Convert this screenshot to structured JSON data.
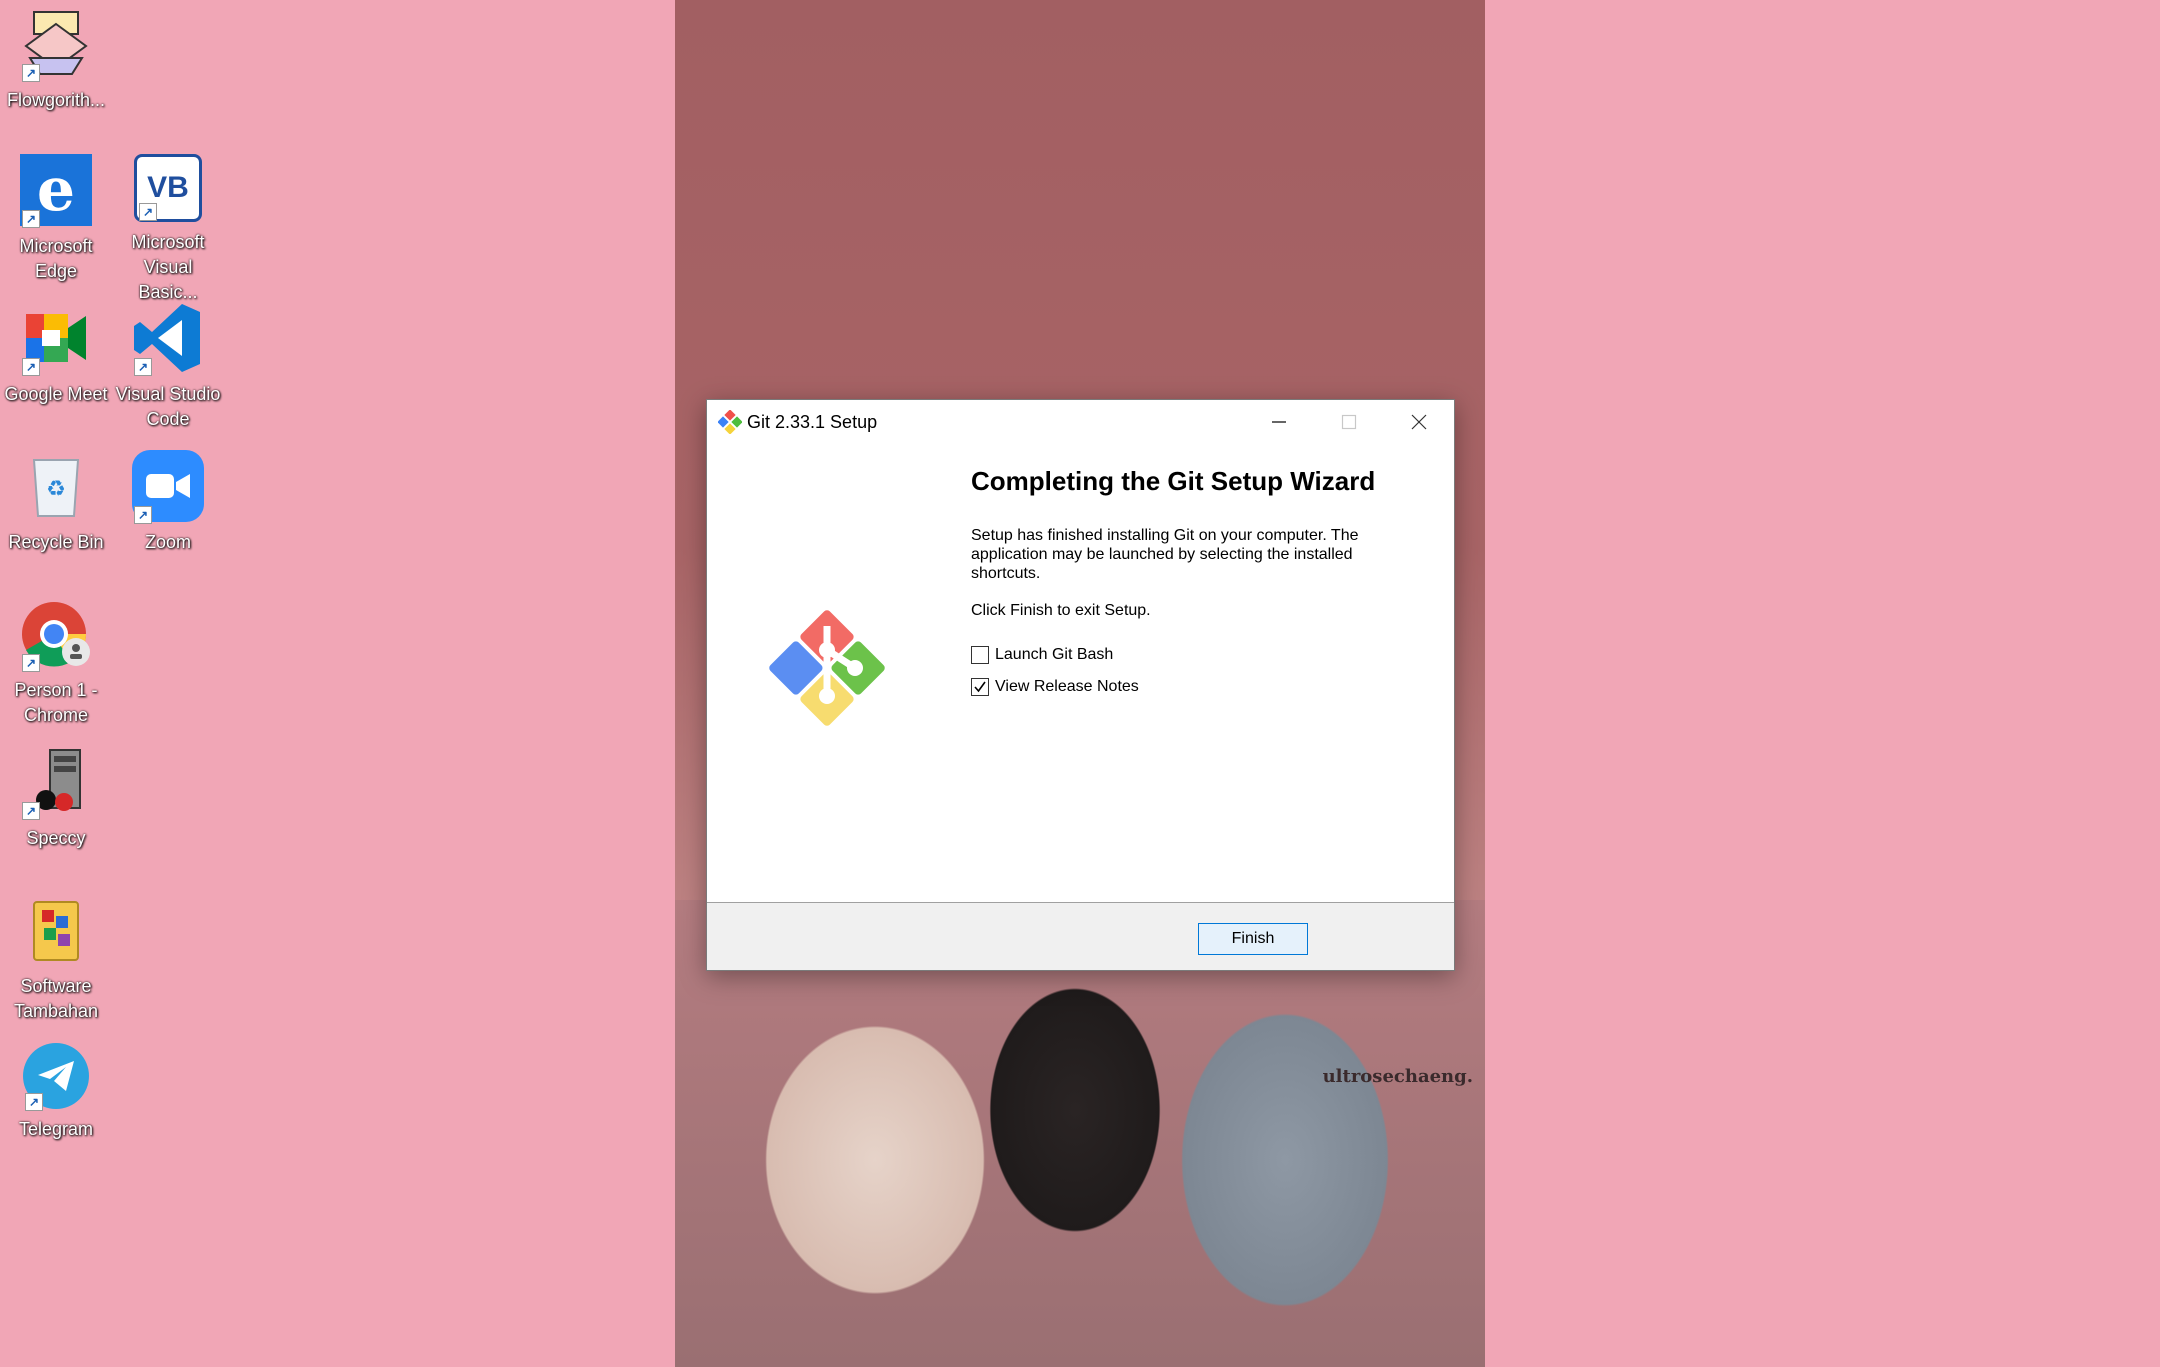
{
  "desktop": {
    "icons": [
      {
        "label": "Flowgorith...",
        "icon": "flowgorithm-icon"
      },
      {
        "label": "Microsoft Edge",
        "icon": "edge-icon"
      },
      {
        "label": "Microsoft Visual Basic...",
        "icon": "visual-basic-icon"
      },
      {
        "label": "Google Meet",
        "icon": "google-meet-icon"
      },
      {
        "label": "Visual Studio Code",
        "icon": "vscode-icon"
      },
      {
        "label": "Recycle Bin",
        "icon": "recycle-bin-icon"
      },
      {
        "label": "Zoom",
        "icon": "zoom-icon"
      },
      {
        "label": "Person 1 - Chrome",
        "icon": "chrome-icon"
      },
      {
        "label": "Speccy",
        "icon": "speccy-icon"
      },
      {
        "label": "Software Tambahan",
        "icon": "folder-icon"
      },
      {
        "label": "Telegram",
        "icon": "telegram-icon"
      }
    ]
  },
  "wallpaper": {
    "watermark": "ultrosechaeng."
  },
  "dialog": {
    "title": "Git 2.33.1 Setup",
    "heading": "Completing the Git Setup Wizard",
    "description": "Setup has finished installing Git on your computer. The application may be launched by selecting the installed shortcuts.",
    "instruction": "Click Finish to exit Setup.",
    "options": [
      {
        "label": "Launch Git Bash",
        "checked": false
      },
      {
        "label": "View Release Notes",
        "checked": true
      }
    ],
    "finish_label": "Finish"
  },
  "colors": {
    "desktop_bg": "#f1a6b6",
    "accent": "#0078d7",
    "git_red": "#f0504a",
    "git_green": "#4ebd3c",
    "git_blue": "#3b82f6",
    "git_yellow": "#f5d33c"
  }
}
